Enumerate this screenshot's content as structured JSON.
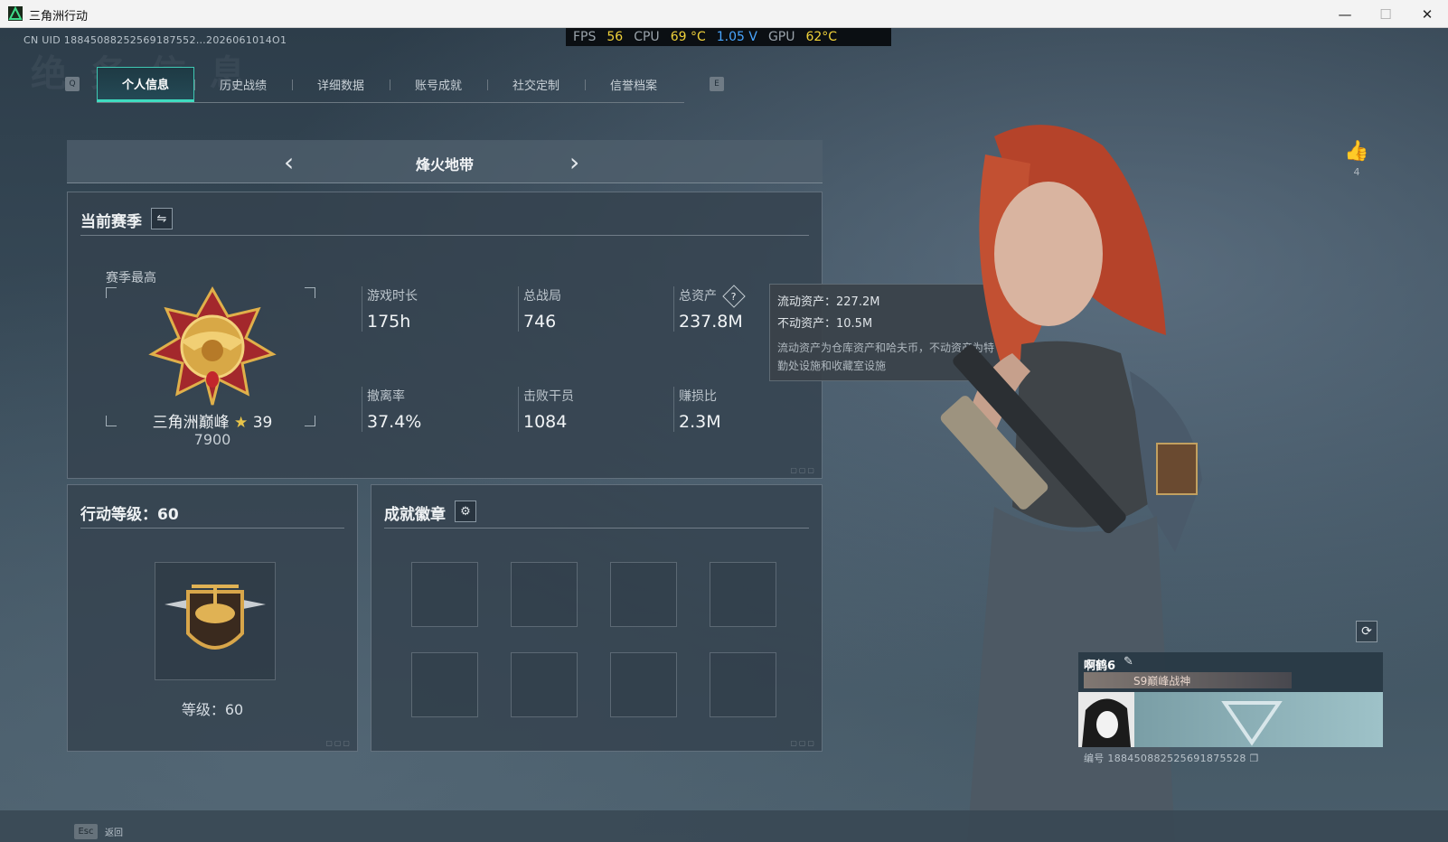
{
  "window": {
    "title": "三角洲行动"
  },
  "overlay": {
    "uid": "CN UID 18845088252569187552…2026061014O1",
    "fps_label": "FPS",
    "fps": "56",
    "cpu_label": "CPU",
    "cpu_temp": "69 °C",
    "voltage": "1.05 V",
    "gpu_label": "GPU",
    "gpu_temp": "62°C"
  },
  "tabs": {
    "left_key": "Q",
    "right_key": "E",
    "items": [
      {
        "label": "个人信息",
        "active": true
      },
      {
        "label": "历史战绩"
      },
      {
        "label": "详细数据"
      },
      {
        "label": "账号成就"
      },
      {
        "label": "社交定制"
      },
      {
        "label": "信誉档案"
      }
    ]
  },
  "mode": {
    "title": "烽火地带",
    "prev": "‹",
    "next": "›"
  },
  "season": {
    "title": "当前赛季",
    "best_label": "赛季最高",
    "rank_name": "三角洲巅峰",
    "rank_star": "★",
    "rank_stars": "39",
    "rank_score": "7900",
    "stats": [
      {
        "label": "游戏时长",
        "value": "175h"
      },
      {
        "label": "总战局",
        "value": "746"
      },
      {
        "label": "总资产",
        "value": "237.8M",
        "help": "?"
      },
      {
        "label": "撤离率",
        "value": "37.4%"
      },
      {
        "label": "击败干员",
        "value": "1084"
      },
      {
        "label": "赚损比",
        "value": "2.3M"
      }
    ]
  },
  "tooltip": {
    "liquid": "流动资产：227.2M",
    "fixed": "不动资产：10.5M",
    "note": "流动资产为仓库资产和哈夫币，不动资产为特勤处设施和收藏室设施"
  },
  "level": {
    "title": "行动等级：60",
    "label": "等级：60"
  },
  "achievements": {
    "title": "成就徽章"
  },
  "profile": {
    "likes": "4",
    "name": "啊鹤6",
    "title": "S9巅峰战神",
    "id": "编号 188450882525691875528"
  },
  "footer": {
    "esc_key": "Esc",
    "esc_label": "返回"
  },
  "colors": {
    "accent": "#3fdcc0",
    "gold": "#e8c44a",
    "fps_yellow": "#f0d23a",
    "voltage_blue": "#49a6ff"
  }
}
